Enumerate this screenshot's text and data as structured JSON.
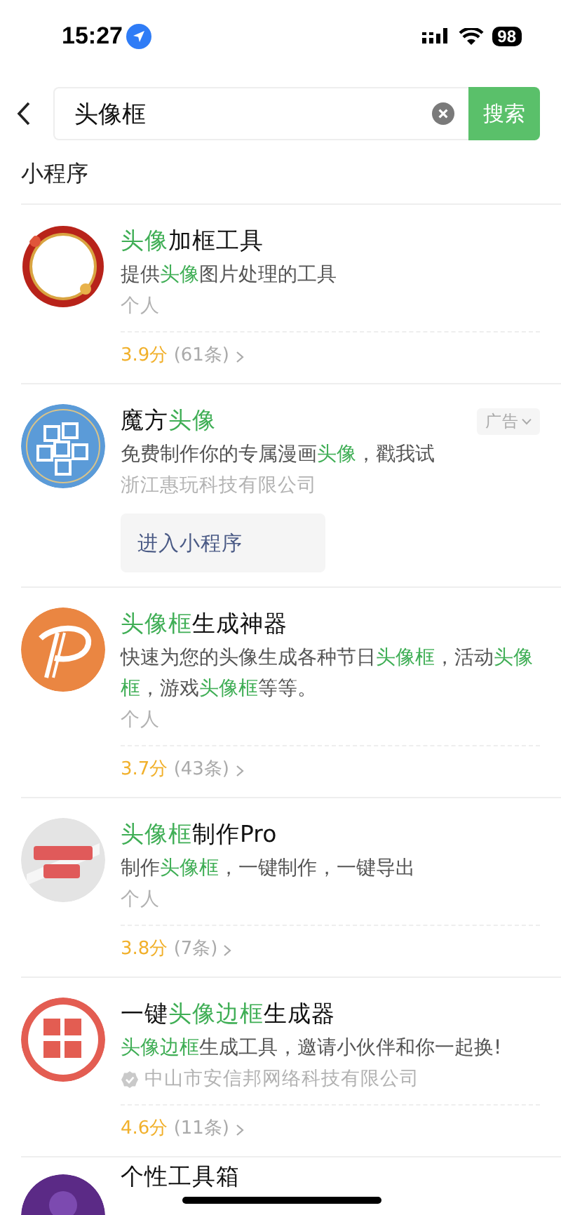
{
  "status_bar": {
    "time": "15:27",
    "battery": "98"
  },
  "search": {
    "value": "头像框",
    "button": "搜索"
  },
  "section_title": "小程序",
  "results": [
    {
      "kind": "program",
      "title": [
        {
          "text": "头像",
          "highlight": true
        },
        {
          "text": "加框工具",
          "highlight": false
        }
      ],
      "description": [
        {
          "text": "提供",
          "highlight": false
        },
        {
          "text": "头像",
          "highlight": true
        },
        {
          "text": "图片处理的工具",
          "highlight": false
        }
      ],
      "owner": "个人",
      "rating": "3.9分",
      "reviews": "(61条)"
    },
    {
      "kind": "ad",
      "title": [
        {
          "text": "魔方",
          "highlight": false
        },
        {
          "text": "头像",
          "highlight": true
        }
      ],
      "ad_label": "广告",
      "description": [
        {
          "text": "免费制作你的专属漫画",
          "highlight": false
        },
        {
          "text": "头像",
          "highlight": true
        },
        {
          "text": "，戳我试",
          "highlight": false
        }
      ],
      "owner": "浙江惠玩科技有限公司",
      "action": "进入小程序"
    },
    {
      "kind": "program",
      "title": [
        {
          "text": "头像框",
          "highlight": true
        },
        {
          "text": "生成神器",
          "highlight": false
        }
      ],
      "description": [
        {
          "text": "快速为您的头像生成各种节日",
          "highlight": false
        },
        {
          "text": "头像框",
          "highlight": true
        },
        {
          "text": "，活动",
          "highlight": false
        },
        {
          "text": "头像框",
          "highlight": true
        },
        {
          "text": "，游戏",
          "highlight": false
        },
        {
          "text": "头像框",
          "highlight": true
        },
        {
          "text": "等等。",
          "highlight": false
        }
      ],
      "owner": "个人",
      "rating": "3.7分",
      "reviews": "(43条)"
    },
    {
      "kind": "program",
      "title": [
        {
          "text": "头像框",
          "highlight": true
        },
        {
          "text": "制作Pro",
          "highlight": false
        }
      ],
      "description": [
        {
          "text": "制作",
          "highlight": false
        },
        {
          "text": "头像框",
          "highlight": true
        },
        {
          "text": "，一键制作，一键导出",
          "highlight": false
        }
      ],
      "owner": "个人",
      "rating": "3.8分",
      "reviews": "(7条)"
    },
    {
      "kind": "program",
      "title": [
        {
          "text": "一键",
          "highlight": false
        },
        {
          "text": "头像边框",
          "highlight": true
        },
        {
          "text": "生成器",
          "highlight": false
        }
      ],
      "description": [
        {
          "text": "头像边框",
          "highlight": true
        },
        {
          "text": "生成工具，邀请小伙伴和你一起换!",
          "highlight": false
        }
      ],
      "owner": "中山市安信邦网络科技有限公司",
      "verified": true,
      "rating": "4.6分",
      "reviews": "(11条)"
    },
    {
      "kind": "partial",
      "title": [
        {
          "text": "个性工具箱",
          "highlight": false
        }
      ]
    }
  ]
}
